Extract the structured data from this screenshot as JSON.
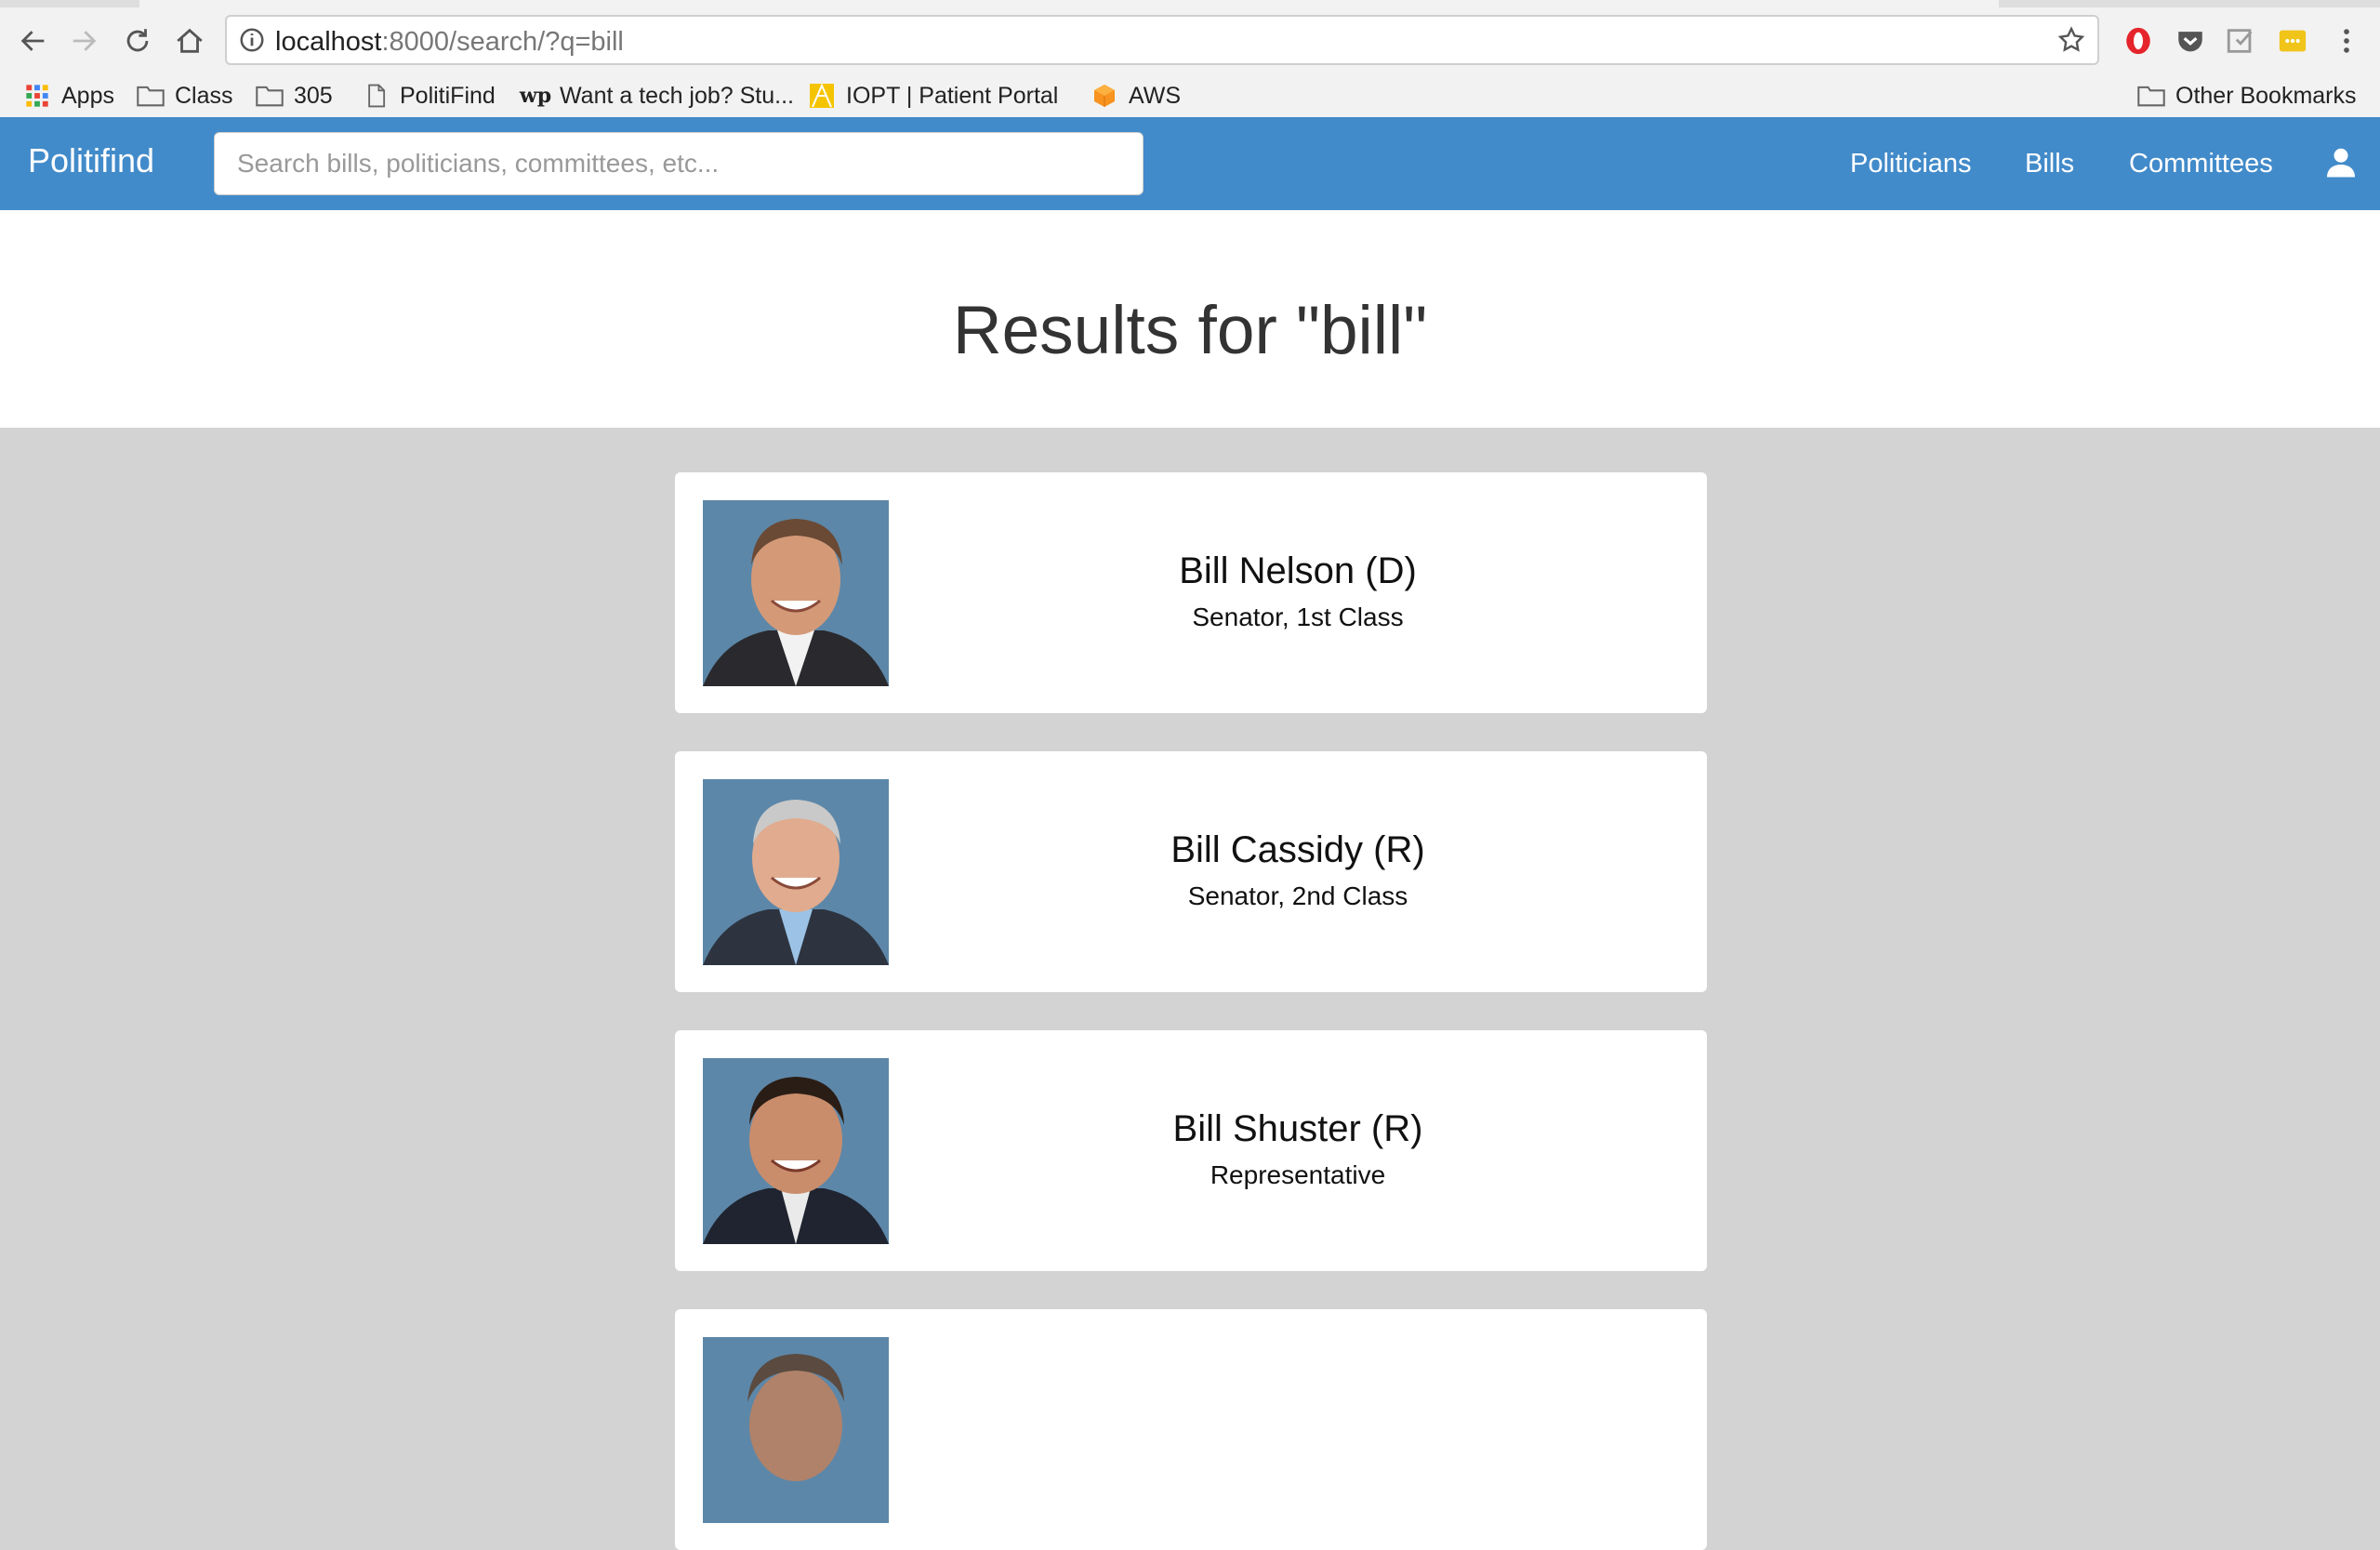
{
  "browser": {
    "url_host": "localhost",
    "url_rest": ":8000/search/?q=bill",
    "bookmarks": [
      {
        "label": "Apps",
        "icon": "apps-grid-icon"
      },
      {
        "label": "Class",
        "icon": "folder-icon"
      },
      {
        "label": "305",
        "icon": "folder-icon"
      },
      {
        "label": "PolitiFind",
        "icon": "page-icon"
      },
      {
        "label": "Want a tech job? Stu...",
        "icon": "wp-logo-icon"
      },
      {
        "label": "IOPT | Patient Portal",
        "icon": "iopt-logo-icon"
      },
      {
        "label": "AWS",
        "icon": "aws-cube-icon"
      }
    ],
    "other_bookmarks": "Other Bookmarks"
  },
  "navbar": {
    "brand": "Politifind",
    "search_placeholder": "Search bills, politicians, committees, etc...",
    "links": [
      "Politicians",
      "Bills",
      "Committees"
    ],
    "color": "#428bca"
  },
  "page": {
    "title": "Results for \"bill\""
  },
  "results": [
    {
      "name": "Bill Nelson (D)",
      "role": "Senator, 1st Class"
    },
    {
      "name": "Bill Cassidy (R)",
      "role": "Senator, 2nd Class"
    },
    {
      "name": "Bill Shuster (R)",
      "role": "Representative"
    },
    {
      "name": "",
      "role": ""
    }
  ]
}
